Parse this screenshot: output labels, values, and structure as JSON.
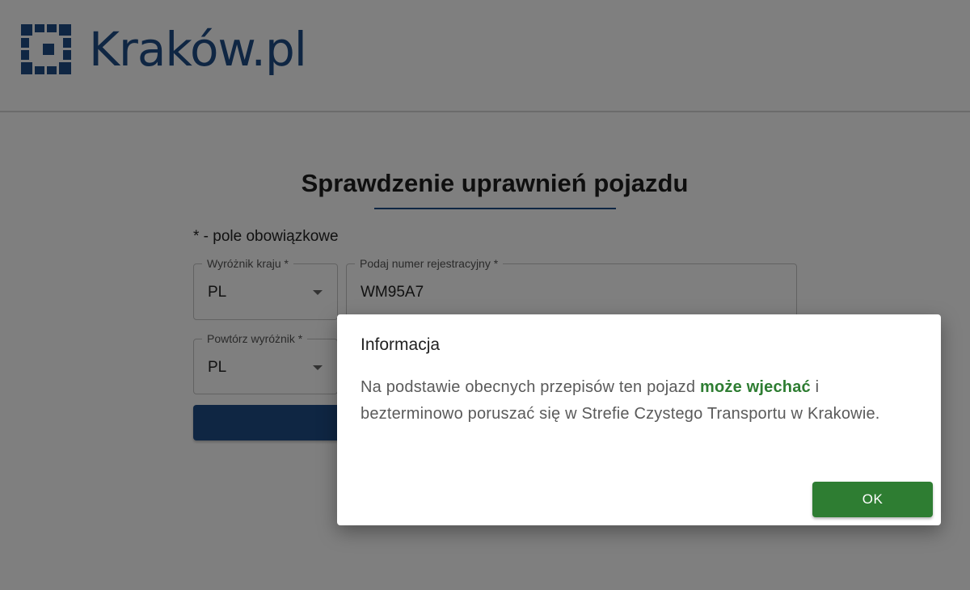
{
  "header": {
    "logo_text": "Kraków.pl",
    "brand_color": "#1f4d86"
  },
  "form": {
    "title": "Sprawdzenie uprawnień pojazdu",
    "required_note": "* - pole obowiązkowe",
    "country_field": {
      "label": "Wyróżnik kraju *",
      "value": "PL"
    },
    "plate_field": {
      "label": "Podaj numer rejestracyjny *",
      "value": "WM95A7"
    },
    "repeat_country_field": {
      "label": "Powtórz wyróżnik *",
      "value": "PL"
    },
    "submit_button_color": "#1f4d86"
  },
  "dialog": {
    "title": "Informacja",
    "message_before": "Na podstawie obecnych przepisów ten pojazd ",
    "message_highlight": "może wjechać",
    "message_after": " i bezterminowo poruszać się w Strefie Czystego Transportu w Krakowie.",
    "highlight_color": "#2e7d32",
    "ok_label": "OK",
    "ok_color": "#2e7d32"
  },
  "icons": {
    "logo": "krakow-logo-icon",
    "dropdown": "chevron-down-icon"
  }
}
